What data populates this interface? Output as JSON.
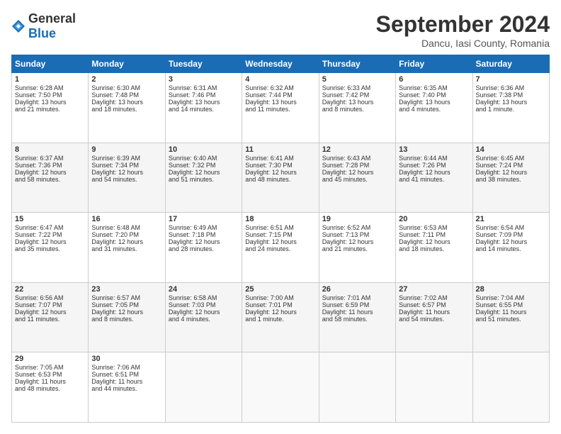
{
  "header": {
    "logo_general": "General",
    "logo_blue": "Blue",
    "title": "September 2024",
    "location": "Dancu, Iasi County, Romania"
  },
  "weekdays": [
    "Sunday",
    "Monday",
    "Tuesday",
    "Wednesday",
    "Thursday",
    "Friday",
    "Saturday"
  ],
  "weeks": [
    [
      {
        "day": "1",
        "sunrise": "6:28 AM",
        "sunset": "7:50 PM",
        "daylight": "13 hours and 21 minutes."
      },
      {
        "day": "2",
        "sunrise": "6:30 AM",
        "sunset": "7:48 PM",
        "daylight": "13 hours and 18 minutes."
      },
      {
        "day": "3",
        "sunrise": "6:31 AM",
        "sunset": "7:46 PM",
        "daylight": "13 hours and 14 minutes."
      },
      {
        "day": "4",
        "sunrise": "6:32 AM",
        "sunset": "7:44 PM",
        "daylight": "13 hours and 11 minutes."
      },
      {
        "day": "5",
        "sunrise": "6:33 AM",
        "sunset": "7:42 PM",
        "daylight": "13 hours and 8 minutes."
      },
      {
        "day": "6",
        "sunrise": "6:35 AM",
        "sunset": "7:40 PM",
        "daylight": "13 hours and 4 minutes."
      },
      {
        "day": "7",
        "sunrise": "6:36 AM",
        "sunset": "7:38 PM",
        "daylight": "13 hours and 1 minute."
      }
    ],
    [
      {
        "day": "8",
        "sunrise": "6:37 AM",
        "sunset": "7:36 PM",
        "daylight": "12 hours and 58 minutes."
      },
      {
        "day": "9",
        "sunrise": "6:39 AM",
        "sunset": "7:34 PM",
        "daylight": "12 hours and 54 minutes."
      },
      {
        "day": "10",
        "sunrise": "6:40 AM",
        "sunset": "7:32 PM",
        "daylight": "12 hours and 51 minutes."
      },
      {
        "day": "11",
        "sunrise": "6:41 AM",
        "sunset": "7:30 PM",
        "daylight": "12 hours and 48 minutes."
      },
      {
        "day": "12",
        "sunrise": "6:43 AM",
        "sunset": "7:28 PM",
        "daylight": "12 hours and 45 minutes."
      },
      {
        "day": "13",
        "sunrise": "6:44 AM",
        "sunset": "7:26 PM",
        "daylight": "12 hours and 41 minutes."
      },
      {
        "day": "14",
        "sunrise": "6:45 AM",
        "sunset": "7:24 PM",
        "daylight": "12 hours and 38 minutes."
      }
    ],
    [
      {
        "day": "15",
        "sunrise": "6:47 AM",
        "sunset": "7:22 PM",
        "daylight": "12 hours and 35 minutes."
      },
      {
        "day": "16",
        "sunrise": "6:48 AM",
        "sunset": "7:20 PM",
        "daylight": "12 hours and 31 minutes."
      },
      {
        "day": "17",
        "sunrise": "6:49 AM",
        "sunset": "7:18 PM",
        "daylight": "12 hours and 28 minutes."
      },
      {
        "day": "18",
        "sunrise": "6:51 AM",
        "sunset": "7:15 PM",
        "daylight": "12 hours and 24 minutes."
      },
      {
        "day": "19",
        "sunrise": "6:52 AM",
        "sunset": "7:13 PM",
        "daylight": "12 hours and 21 minutes."
      },
      {
        "day": "20",
        "sunrise": "6:53 AM",
        "sunset": "7:11 PM",
        "daylight": "12 hours and 18 minutes."
      },
      {
        "day": "21",
        "sunrise": "6:54 AM",
        "sunset": "7:09 PM",
        "daylight": "12 hours and 14 minutes."
      }
    ],
    [
      {
        "day": "22",
        "sunrise": "6:56 AM",
        "sunset": "7:07 PM",
        "daylight": "12 hours and 11 minutes."
      },
      {
        "day": "23",
        "sunrise": "6:57 AM",
        "sunset": "7:05 PM",
        "daylight": "12 hours and 8 minutes."
      },
      {
        "day": "24",
        "sunrise": "6:58 AM",
        "sunset": "7:03 PM",
        "daylight": "12 hours and 4 minutes."
      },
      {
        "day": "25",
        "sunrise": "7:00 AM",
        "sunset": "7:01 PM",
        "daylight": "12 hours and 1 minute."
      },
      {
        "day": "26",
        "sunrise": "7:01 AM",
        "sunset": "6:59 PM",
        "daylight": "11 hours and 58 minutes."
      },
      {
        "day": "27",
        "sunrise": "7:02 AM",
        "sunset": "6:57 PM",
        "daylight": "11 hours and 54 minutes."
      },
      {
        "day": "28",
        "sunrise": "7:04 AM",
        "sunset": "6:55 PM",
        "daylight": "11 hours and 51 minutes."
      }
    ],
    [
      {
        "day": "29",
        "sunrise": "7:05 AM",
        "sunset": "6:53 PM",
        "daylight": "11 hours and 48 minutes."
      },
      {
        "day": "30",
        "sunrise": "7:06 AM",
        "sunset": "6:51 PM",
        "daylight": "11 hours and 44 minutes."
      },
      null,
      null,
      null,
      null,
      null
    ]
  ]
}
